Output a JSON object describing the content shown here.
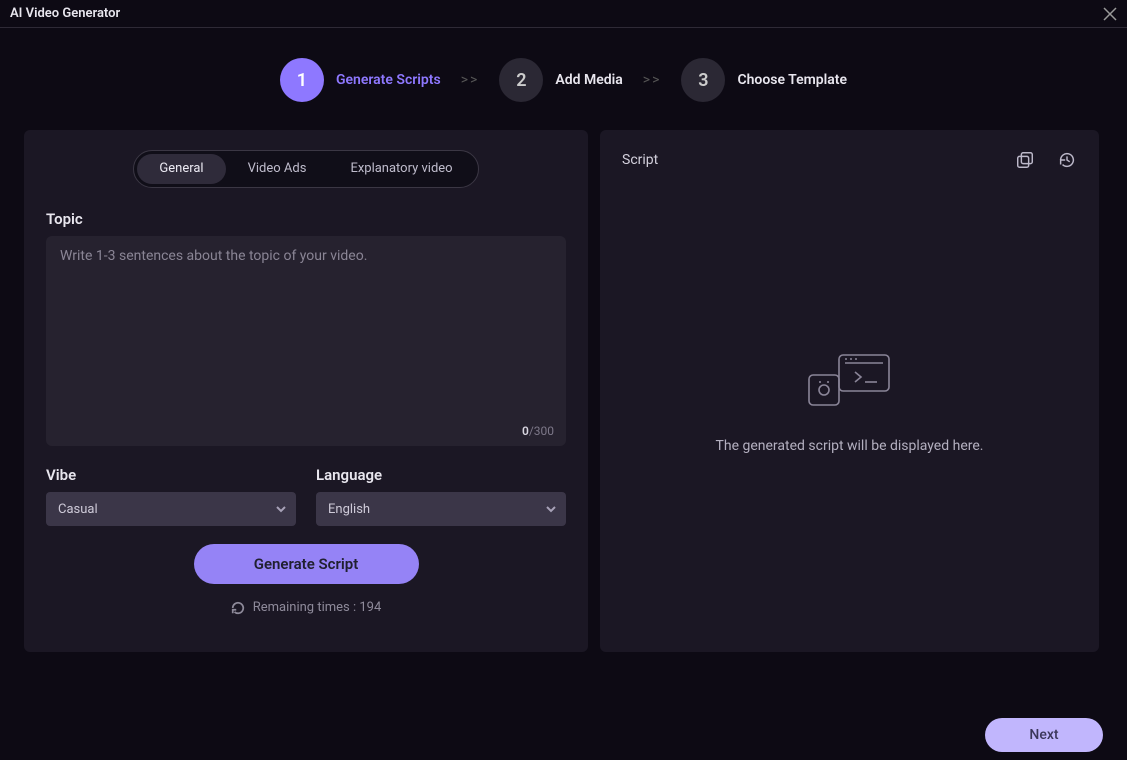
{
  "window": {
    "title": "AI Video Generator"
  },
  "steps": {
    "items": [
      {
        "num": "1",
        "label": "Generate Scripts",
        "active": true
      },
      {
        "num": "2",
        "label": "Add Media",
        "active": false
      },
      {
        "num": "3",
        "label": "Choose Template",
        "active": false
      }
    ]
  },
  "tabs": {
    "items": [
      {
        "label": "General",
        "active": true
      },
      {
        "label": "Video Ads",
        "active": false
      },
      {
        "label": "Explanatory video",
        "active": false
      }
    ]
  },
  "topic": {
    "label": "Topic",
    "placeholder": "Write 1-3 sentences about the topic of your video.",
    "value": "",
    "count": "0",
    "max": "/300"
  },
  "vibe": {
    "label": "Vibe",
    "value": "Casual"
  },
  "language": {
    "label": "Language",
    "value": "English"
  },
  "generate": {
    "label": "Generate Script"
  },
  "remaining": {
    "label": "Remaining times : 194"
  },
  "script_panel": {
    "title": "Script",
    "placeholder": "The generated script will be displayed here."
  },
  "footer": {
    "next": "Next"
  }
}
